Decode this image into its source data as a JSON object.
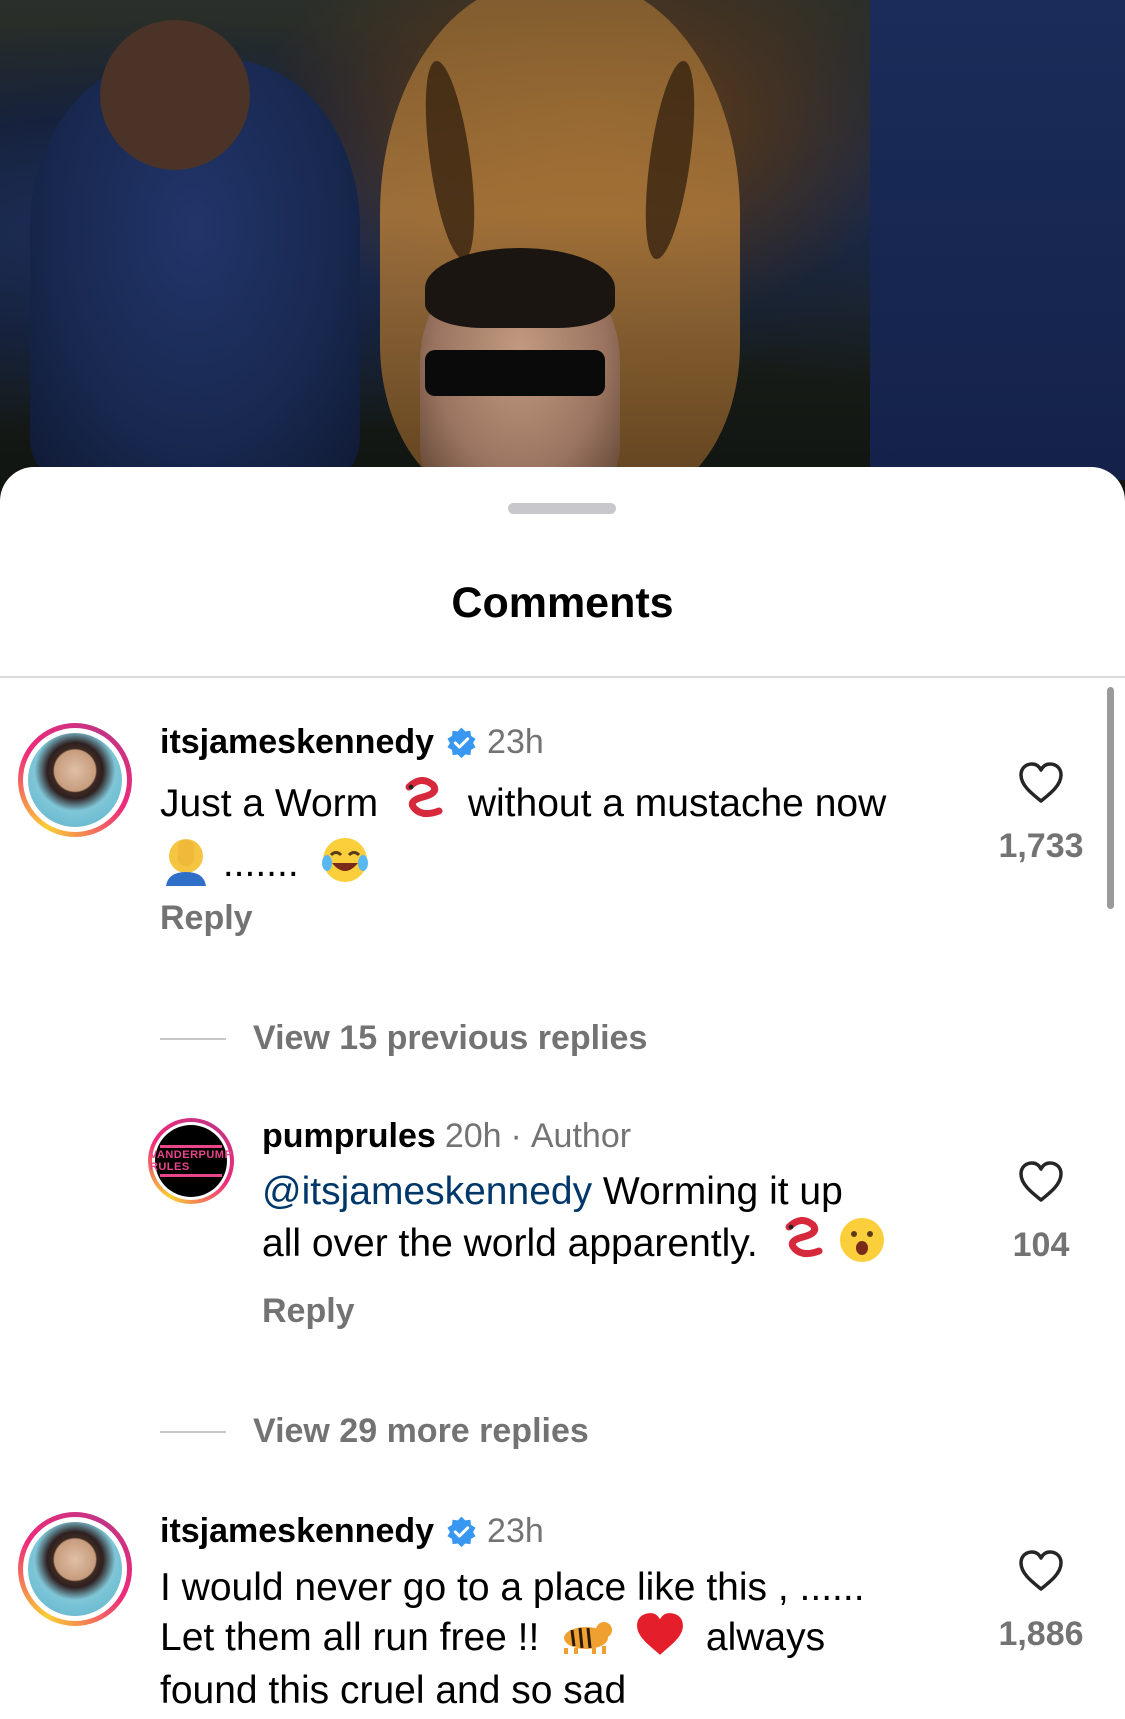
{
  "sheet": {
    "title": "Comments"
  },
  "comments": [
    {
      "username": "itsjameskennedy",
      "verified": true,
      "time": "23h",
      "line1_a": "Just a Worm",
      "line1_b": "without a mustache now",
      "line2": ".......",
      "reply_label": "Reply",
      "likes": "1,733"
    },
    {
      "username": "itsjameskennedy",
      "verified": true,
      "time": "23h",
      "line1": "I would never go to a place like this , ......",
      "line2_a": "Let them all run free !!",
      "line2_b": "always",
      "line3": "found this cruel and so sad",
      "likes": "1,886"
    }
  ],
  "reply": {
    "username": "pumprules",
    "time": "20h",
    "separator": "·",
    "badge": "Author",
    "mention": "@itsjameskennedy",
    "text_a": "Worming it up",
    "text_b": "all over the world apparently.",
    "reply_label": "Reply",
    "likes": "104",
    "avatar_brand": "VANDERPUMP RULES"
  },
  "view_previous": "View 15 previous replies",
  "view_more": "View 29 more replies",
  "colors": {
    "mention": "#00376b",
    "muted": "#737373",
    "verified": "#3897f0"
  },
  "icons": [
    "heart-icon",
    "verified-badge-icon",
    "worm-emoji",
    "facepalm-emoji",
    "laughing-emoji",
    "astonished-emoji",
    "tiger-emoji",
    "red-heart-emoji"
  ]
}
